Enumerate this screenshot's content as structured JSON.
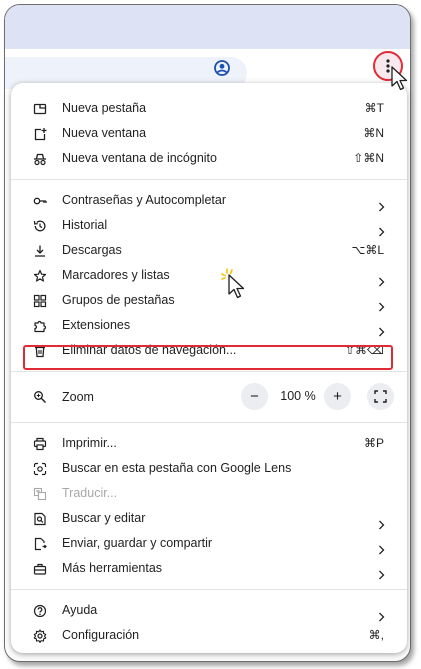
{
  "menu": {
    "sections": [
      [
        {
          "name": "new-tab",
          "icon": "new-tab-icon",
          "label": "Nueva pestaña",
          "shortcut": "⌘T"
        },
        {
          "name": "new-window",
          "icon": "new-window-icon",
          "label": "Nueva ventana",
          "shortcut": "⌘N"
        },
        {
          "name": "new-incognito",
          "icon": "incognito-icon",
          "label": "Nueva ventana de incógnito",
          "shortcut": "⇧⌘N"
        }
      ],
      [
        {
          "name": "passwords",
          "icon": "key-icon",
          "label": "Contraseñas y Autocompletar",
          "submenu": true
        },
        {
          "name": "history",
          "icon": "history-icon",
          "label": "Historial",
          "submenu": true
        },
        {
          "name": "downloads",
          "icon": "download-icon",
          "label": "Descargas",
          "shortcut": "⌥⌘L"
        },
        {
          "name": "bookmarks",
          "icon": "star-icon",
          "label": "Marcadores y listas",
          "submenu": true
        },
        {
          "name": "tab-groups",
          "icon": "grid-icon",
          "label": "Grupos de pestañas",
          "submenu": true
        },
        {
          "name": "extensions",
          "icon": "puzzle-icon",
          "label": "Extensiones",
          "submenu": true
        },
        {
          "name": "clear-data",
          "icon": "trash-icon",
          "label": "Eliminar datos de navegación...",
          "shortcut": "⇧⌘⌫",
          "highlighted": true
        }
      ],
      [
        {
          "name": "print",
          "icon": "print-icon",
          "label": "Imprimir...",
          "shortcut": "⌘P"
        },
        {
          "name": "lens",
          "icon": "lens-icon",
          "label": "Buscar en esta pestaña con Google Lens"
        },
        {
          "name": "translate",
          "icon": "translate-icon",
          "label": "Traducir...",
          "disabled": true
        },
        {
          "name": "find-edit",
          "icon": "find-icon",
          "label": "Buscar y editar",
          "submenu": true
        },
        {
          "name": "send-save",
          "icon": "send-icon",
          "label": "Enviar, guardar y compartir",
          "submenu": true
        },
        {
          "name": "more-tools",
          "icon": "toolbox-icon",
          "label": "Más herramientas",
          "submenu": true
        }
      ],
      [
        {
          "name": "help",
          "icon": "help-icon",
          "label": "Ayuda",
          "submenu": true
        },
        {
          "name": "settings",
          "icon": "gear-icon",
          "label": "Configuración",
          "shortcut": "⌘,"
        }
      ]
    ],
    "zoom": {
      "label": "Zoom",
      "minus": "−",
      "plus": "+",
      "value": "100 %"
    }
  },
  "colors": {
    "accent": "#e02b36",
    "tabstrip": "#dde3f5",
    "omnibox": "#eef2fa",
    "profile": "#1a4fb5"
  }
}
